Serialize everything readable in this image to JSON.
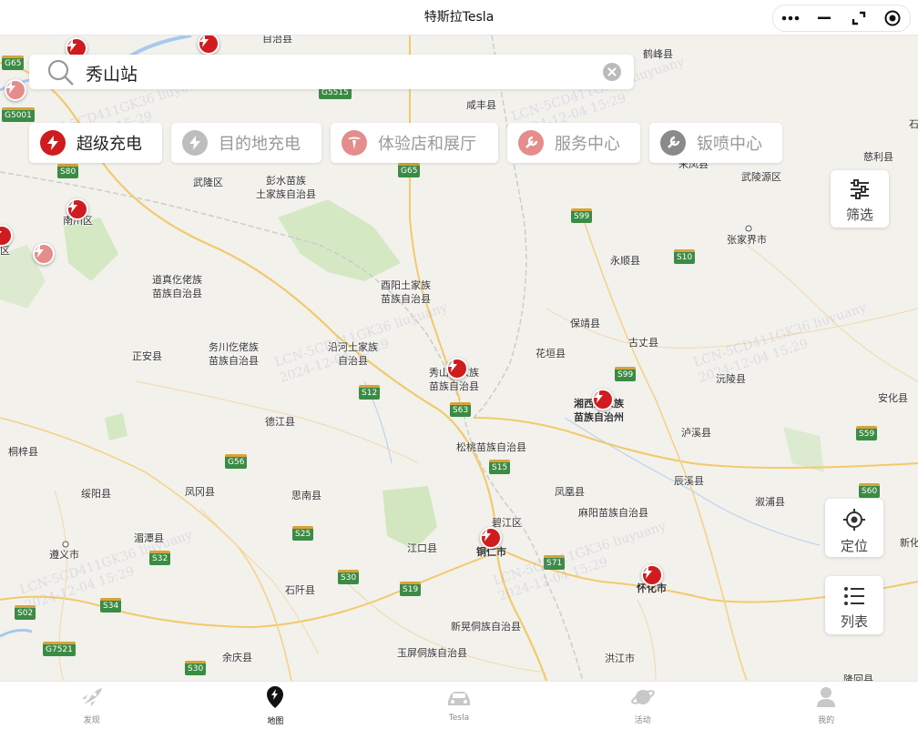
{
  "window": {
    "title": "特斯拉Tesla"
  },
  "search": {
    "query": "秀山站"
  },
  "categories": [
    {
      "label": "超级充电",
      "icon": "supercharger-icon",
      "active": true
    },
    {
      "label": "目的地充电",
      "icon": "destination-charger-icon",
      "active": false
    },
    {
      "label": "体验店和展厅",
      "icon": "tesla-logo-icon",
      "active": false
    },
    {
      "label": "服务中心",
      "icon": "wrench-icon",
      "active": false
    },
    {
      "label": "钣喷中心",
      "icon": "wrench-icon",
      "active": false
    }
  ],
  "side_buttons": {
    "filter": "筛选",
    "locate": "定位",
    "list": "列表"
  },
  "tabs": [
    {
      "label": "发现",
      "icon": "rocket-icon"
    },
    {
      "label": "地图",
      "icon": "map-pin-bolt-icon"
    },
    {
      "label": "Tesla",
      "icon": "car-icon"
    },
    {
      "label": "活动",
      "icon": "planet-icon"
    },
    {
      "label": "我的",
      "icon": "user-icon"
    }
  ],
  "map": {
    "places": [
      "自治县",
      "鹤峰县",
      "咸丰县",
      "来凤县",
      "武陵源区",
      "慈利县",
      "武隆区",
      "彭水苗族\n土家族自治县",
      "南川区",
      "张家界市",
      "永顺县",
      "道真仡佬族\n苗族自治县",
      "酉阳土家族\n苗族自治县",
      "保靖县",
      "古丈县",
      "花垣县",
      "正安县",
      "务川仡佬族\n苗族自治县",
      "沿河土家族\n自治县",
      "秀山土家族\n苗族自治县",
      "湘西土家族\n苗族自治州",
      "沅陵县",
      "安化县",
      "德江县",
      "泸溪县",
      "桐梓县",
      "松桃苗族自治县",
      "辰溪县",
      "绥阳县",
      "凤冈县",
      "思南县",
      "凤凰县",
      "溆浦县",
      "碧江区",
      "麻阳苗族自治县",
      "湄潭县",
      "遵义市",
      "江口县",
      "铜仁市",
      "新化",
      "怀化市",
      "石阡县",
      "新晃侗族自治县",
      "余庆县",
      "玉屏侗族自治县",
      "洪江市",
      "隆回县",
      "石",
      "区"
    ],
    "highways": [
      "G65",
      "G5515",
      "G5001",
      "S80",
      "G65",
      "S99",
      "S10",
      "S12",
      "S63",
      "S99",
      "S15",
      "G56",
      "S59",
      "S60",
      "S25",
      "S32",
      "S30",
      "S19",
      "S71",
      "S34",
      "S02",
      "G7521",
      "S30"
    ],
    "watermark": "LCN-5CD411GK36 liuyuany\n2024-12-04 15:29"
  },
  "colors": {
    "accent": "#d01b1f",
    "accent_faded": "#e58d8d",
    "road_primary": "#f2c96b",
    "shield": "#3a8b44"
  }
}
